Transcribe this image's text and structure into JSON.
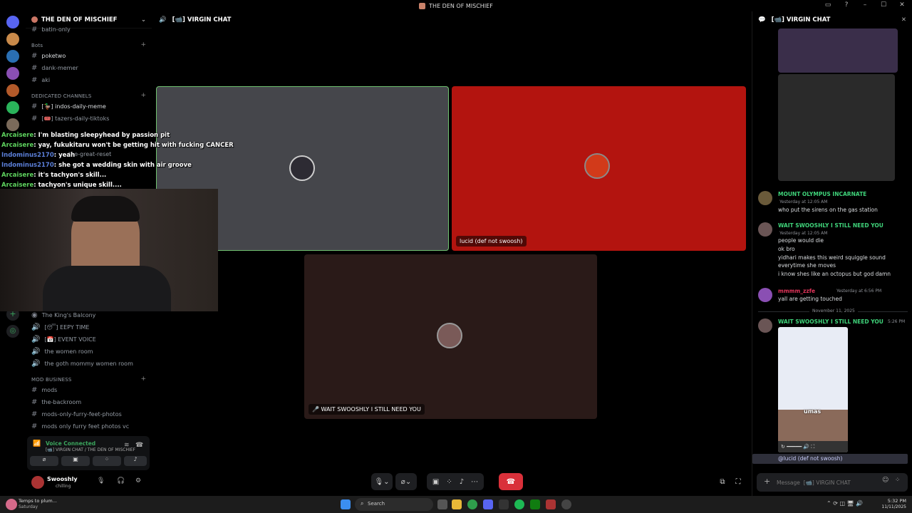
{
  "window": {
    "title": "THE DEN OF MISCHIEF"
  },
  "server": {
    "name": "THE DEN OF MISCHIEF"
  },
  "channels": {
    "top_partial": "batin-only",
    "bots_category": "Bots",
    "bots": [
      "poketwo",
      "dank-memer",
      "aki"
    ],
    "dedicated_category": "DEDICATED CHANNELS",
    "dedicated": [
      "[🦆] indos-daily-meme",
      "[🎟️] tazers-daily-tiktoks",
      "the-great-reset"
    ],
    "voice": [
      "The King's Balcony",
      "[😴] EEPY TIME",
      "[📅] EVENT VOICE",
      "the women room",
      "the goth mommy women room"
    ],
    "mod_category": "MOD BUSINESS",
    "mod": [
      "mods",
      "the-backroom",
      "mods-only-furry-feet-photos",
      "mods only furry feet photos vc"
    ]
  },
  "voice_panel": {
    "status": "Voice Connected",
    "location": "[📹] VIRGIN CHAT / THE DEN OF MISCHIEF"
  },
  "user_panel": {
    "name": "Swooshly",
    "status": "chilling"
  },
  "call": {
    "channel": "[📹] VIRGIN CHAT",
    "tile_lucid": "lucid (def not swoosh)",
    "tile_swooshly": "🎤 WAIT SWOOSHLY I STILL NEED YOU",
    "colors": {
      "tile_self": "#45464b",
      "tile_lucid": "#b3140f",
      "tile_swooshly": "#2a1a18",
      "speaking_border": "#6fc16f",
      "hangup": "#d9303a"
    }
  },
  "chat_overlay": [
    {
      "user": "Arcaisere",
      "text": ": I'm blasting sleepyhead by passion pit",
      "color": "#5ed35e"
    },
    {
      "user": "Arcaisere",
      "text": ": yay, fukukitaru won't be getting hit with fucking CANCER",
      "color": "#5ed35e"
    },
    {
      "user": "Indominus2170",
      "text": ": yeah",
      "color": "#5b7fd8"
    },
    {
      "user": "Indominus2170",
      "text": ": she got a wedding skin with air groove",
      "color": "#5b7fd8"
    },
    {
      "user": "Arcaisere",
      "text": ": it's tachyon's skill...",
      "color": "#5ed35e"
    },
    {
      "user": "Arcaisere",
      "text": ": tachyon's unique skill....",
      "color": "#5ed35e"
    }
  ],
  "text_chat": {
    "title": "[📹] VIRGIN CHAT",
    "messages": [
      {
        "user": "MOUNT OLYMPUS INCARNATE",
        "time": "Yesterday at 12:05 AM",
        "lines": [
          "who put the sirens on the gas station"
        ],
        "color": "#3fd37a"
      },
      {
        "user": "WAIT SWOOSHLY I STILL NEED YOU",
        "time": "Yesterday at 12:05 AM",
        "lines": [
          "people would die",
          "ok bro",
          "yidhari makes this weird squiggle sound",
          "everytime she moves",
          "i know shes like an octopus but god damn"
        ],
        "color": "#3fd37a"
      },
      {
        "user": "mmmm_zzfe",
        "time": "Yesterday at 6:56 PM",
        "lines": [
          "yall are getting touched"
        ],
        "color": "#e0345a"
      }
    ],
    "date_divider": "November 11, 2025",
    "last_user": "WAIT SWOOSHLY I STILL NEED YOU",
    "last_time": "5:26 PM",
    "video_caption": "umas",
    "mention": "@lucid (def not swoosh)",
    "input_placeholder": "Message  [📹] VIRGIN CHAT"
  },
  "taskbar": {
    "weather": "Temps to plum...",
    "weather_sub": "Saturday",
    "search": "Search",
    "time": "5:32 PM",
    "date": "11/11/2025"
  }
}
